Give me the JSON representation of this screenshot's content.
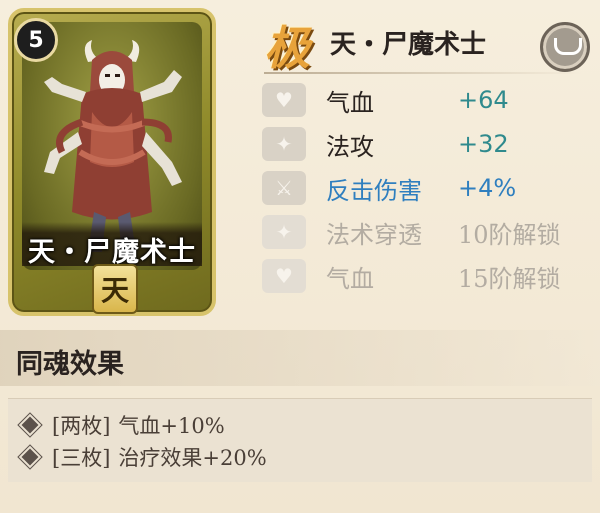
{
  "card": {
    "level": "5",
    "name": "天・尸魔术士",
    "rarity": "天"
  },
  "header": {
    "grade": "极",
    "title": "天・尸魔术士",
    "rank_icon": "hat-icon"
  },
  "stats": [
    {
      "icon": "heart-icon",
      "label": "气血",
      "value": "+64",
      "state": "active"
    },
    {
      "icon": "attack-icon",
      "label": "法攻",
      "value": "+32",
      "state": "active"
    },
    {
      "icon": "sword-icon",
      "label": "反击伤害",
      "value": "+4%",
      "state": "special"
    },
    {
      "icon": "pierce-icon",
      "label": "法术穿透",
      "value": "10阶解锁",
      "state": "locked"
    },
    {
      "icon": "heart-icon",
      "label": "气血",
      "value": "15阶解锁",
      "state": "locked"
    }
  ],
  "soul_section": {
    "title": "同魂效果",
    "effects": [
      {
        "tag": "[两枚]",
        "text": "气血+10%"
      },
      {
        "tag": "[三枚]",
        "text": "治疗效果+20%"
      }
    ]
  },
  "colors": {
    "stat_value": "#2f8a8d",
    "special": "#2f7fbf",
    "locked": "#b3aca2"
  }
}
